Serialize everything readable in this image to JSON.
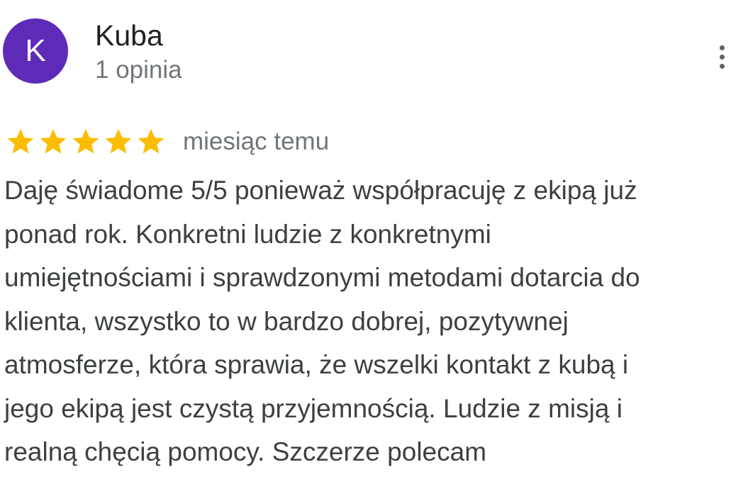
{
  "review": {
    "author": {
      "avatar_initial": "K",
      "avatar_color": "#5e2bb8",
      "name": "Kuba",
      "review_count": "1 opinia"
    },
    "menu_icon": "more-vert-icon",
    "rating": {
      "value": 5,
      "max": 5,
      "star_color": "#fbbc04",
      "star_icon": "star-icon"
    },
    "date": "miesiąc temu",
    "text_lines": [
      "Daję świadome 5/5 ponieważ współpracuję z ekipą już",
      "ponad rok. Konkretni ludzie z konkretnymi",
      "umiejętnościami i sprawdzonymi metodami dotarcia do",
      "klienta, wszystko to w bardzo dobrej, pozytywnej",
      "atmosferze, która sprawia, że wszelki kontakt z kubą i",
      "jego ekipą jest czystą przyjemnością. Ludzie z misją i",
      "realną chęcią pomocy. Szczerze polecam"
    ]
  }
}
